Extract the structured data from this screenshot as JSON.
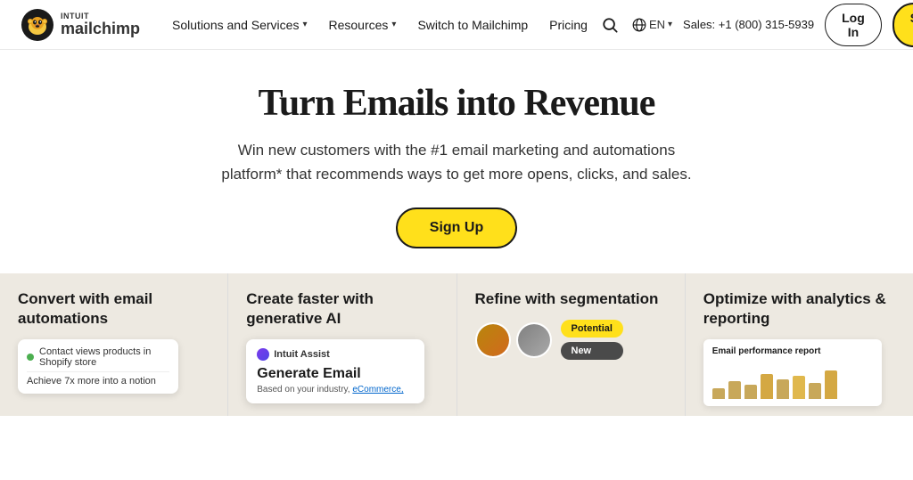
{
  "brand": {
    "intuit": "INTUIT",
    "mailchimp": "mailchimp"
  },
  "nav": {
    "solutions_label": "Solutions and Services",
    "resources_label": "Resources",
    "switch_label": "Switch to Mailchimp",
    "pricing_label": "Pricing",
    "lang_label": "EN",
    "sales_phone": "Sales: +1 (800) 315-5939",
    "login_label": "Log In",
    "signup_label": "Sign Up"
  },
  "hero": {
    "headline": "Turn Emails into Revenue",
    "subtext": "Win new customers with the #1 email marketing and automations platform* that recommends ways to get more opens, clicks, and sales.",
    "cta_label": "Sign Up"
  },
  "cards": [
    {
      "id": "email-automations",
      "title": "Convert with email automations",
      "preview_text": "Contact views products in Shopify store",
      "preview_sub": "Achieve 7x more into a notion"
    },
    {
      "id": "generative-ai",
      "title": "Create faster with generative AI",
      "ai_badge": "Intuit Assist",
      "ai_card_title": "Generate Email",
      "ai_card_sub": "Based on your industry,",
      "ai_link": "eCommerce,"
    },
    {
      "id": "segmentation",
      "title": "Refine with segmentation",
      "pill1": "Potential",
      "pill2": "New"
    },
    {
      "id": "analytics",
      "title": "Optimize with analytics & reporting",
      "report_title": "Email performance report",
      "bars": [
        30,
        50,
        40,
        70,
        55,
        65,
        45,
        80
      ]
    }
  ]
}
